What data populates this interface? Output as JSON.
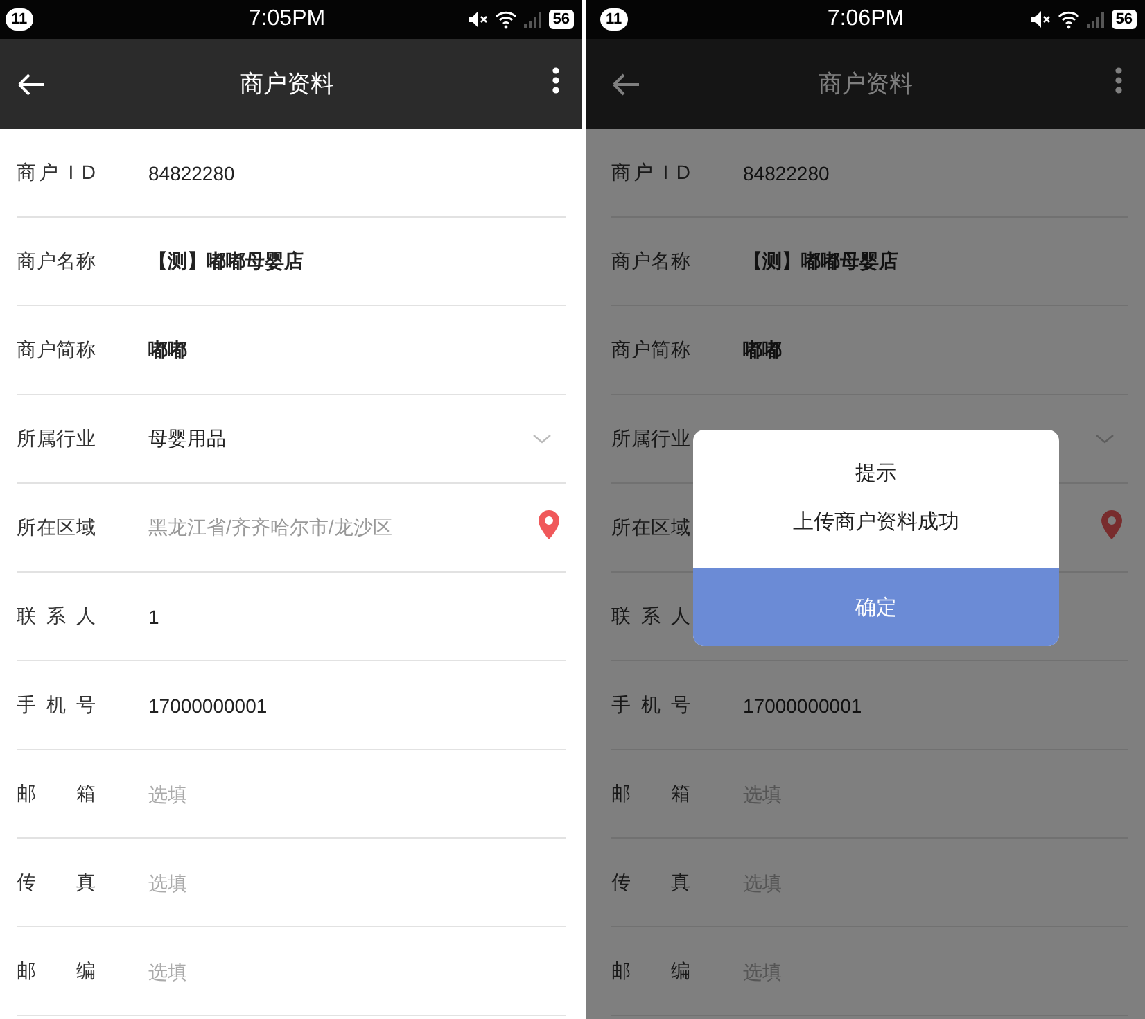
{
  "screens": [
    {
      "status_bar": {
        "notification_count": "11",
        "time": "7:05PM",
        "battery": "56"
      },
      "app_bar": {
        "title": "商户资料"
      },
      "dimmed": false,
      "fields": [
        {
          "kind": "text",
          "label": "商户 I D",
          "value": "84822280",
          "bold": false
        },
        {
          "kind": "text",
          "label": "商户名称",
          "value": "【测】嘟嘟母婴店",
          "bold": true
        },
        {
          "kind": "text",
          "label": "商户简称",
          "value": "嘟嘟",
          "bold": true
        },
        {
          "kind": "select",
          "label": "所属行业",
          "value": "母婴用品",
          "bold": false
        },
        {
          "kind": "location",
          "label": "所在区域",
          "value": "黑龙江省/齐齐哈尔市/龙沙区",
          "bold": false
        },
        {
          "kind": "text",
          "label": "联 系 人",
          "value": "1",
          "bold": false
        },
        {
          "kind": "text",
          "label": "手 机 号",
          "value": "17000000001",
          "bold": false
        },
        {
          "kind": "input",
          "label": "邮 箱",
          "placeholder": "选填"
        },
        {
          "kind": "input",
          "label": "传 真",
          "placeholder": "选填"
        },
        {
          "kind": "input",
          "label": "邮 编",
          "placeholder": "选填"
        }
      ]
    },
    {
      "status_bar": {
        "notification_count": "11",
        "time": "7:06PM",
        "battery": "56"
      },
      "app_bar": {
        "title": "商户资料"
      },
      "dimmed": true,
      "fields": [
        {
          "kind": "text",
          "label": "商户 I D",
          "value": "84822280",
          "bold": false
        },
        {
          "kind": "text",
          "label": "商户名称",
          "value": "【测】嘟嘟母婴店",
          "bold": true
        },
        {
          "kind": "text",
          "label": "商户简称",
          "value": "嘟嘟",
          "bold": true
        },
        {
          "kind": "select",
          "label": "所属行业"
        },
        {
          "kind": "location",
          "label": "所在区域"
        },
        {
          "kind": "text",
          "label": "联 系 人"
        },
        {
          "kind": "text",
          "label": "手 机 号",
          "value": "17000000001",
          "bold": false
        },
        {
          "kind": "input",
          "label": "邮 箱",
          "placeholder": "选填"
        },
        {
          "kind": "input",
          "label": "传 真",
          "placeholder": "选填"
        },
        {
          "kind": "input",
          "label": "邮 编",
          "placeholder": "选填"
        }
      ],
      "dialog": {
        "title": "提示",
        "message": "上传商户资料成功",
        "button": "确定"
      }
    }
  ]
}
